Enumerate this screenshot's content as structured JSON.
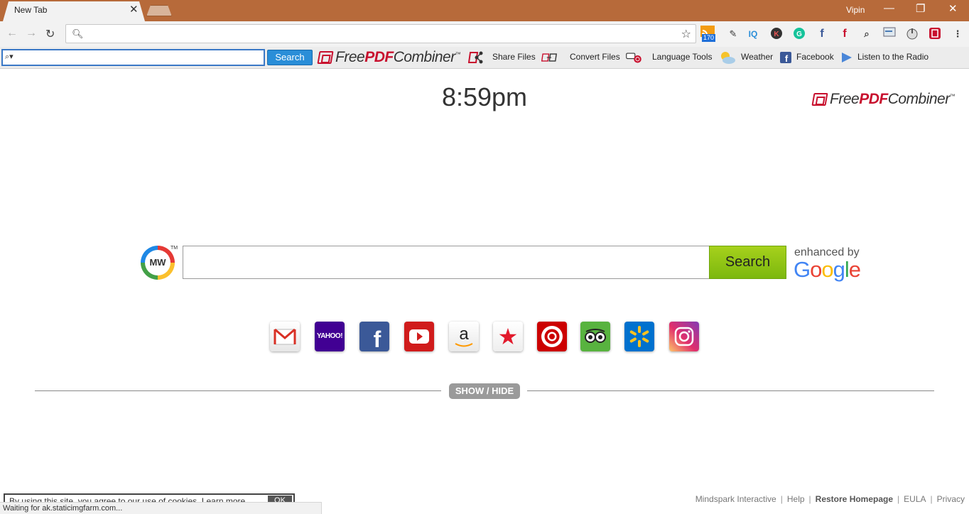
{
  "browser": {
    "tab_title": "New Tab",
    "tab_close_glyph": "✕",
    "user_name": "Vipin",
    "window_controls": {
      "minimize": "—",
      "restore": "❐",
      "close": "✕"
    },
    "rss_badge": "170",
    "address_value": ""
  },
  "toolbar": {
    "search_value": "",
    "search_button": "Search",
    "logo": {
      "prefix": "Free",
      "highlight": "PDF",
      "suffix": "Combiner",
      "tm": "™"
    },
    "items": [
      {
        "label": "Share Files",
        "icon": "share-files-icon"
      },
      {
        "label": "Convert Files",
        "icon": "convert-files-icon"
      },
      {
        "label": "Language Tools",
        "icon": "language-tools-icon"
      },
      {
        "label": "Weather",
        "icon": "weather-icon"
      },
      {
        "label": "Facebook",
        "icon": "facebook-icon"
      },
      {
        "label": "Listen to the Radio",
        "icon": "radio-play-icon"
      }
    ]
  },
  "page": {
    "clock": "8:59pm",
    "brand_logo": {
      "prefix": "Free",
      "highlight": "PDF",
      "suffix": "Combiner",
      "tm": "™"
    },
    "mw_logo": "MW",
    "mw_tm": "TM",
    "search_value": "",
    "search_button": "Search",
    "enhanced_by": "enhanced by",
    "google": [
      "G",
      "o",
      "o",
      "g",
      "l",
      "e"
    ],
    "google_colors": [
      "#4285F4",
      "#EA4335",
      "#FBBC05",
      "#4285F4",
      "#34A853",
      "#EA4335"
    ],
    "shortcuts": [
      {
        "name": "gmail",
        "label": ""
      },
      {
        "name": "yahoo",
        "label": "YAHOO!"
      },
      {
        "name": "facebook",
        "label": "f"
      },
      {
        "name": "youtube",
        "label": ""
      },
      {
        "name": "amazon",
        "label": "a"
      },
      {
        "name": "macys",
        "label": "★"
      },
      {
        "name": "target",
        "label": ""
      },
      {
        "name": "tripadvisor",
        "label": ""
      },
      {
        "name": "walmart",
        "label": ""
      },
      {
        "name": "instagram",
        "label": ""
      }
    ],
    "show_hide": "SHOW / HIDE"
  },
  "footer": {
    "links": [
      "Mindspark Interactive",
      "Help",
      "Restore Homepage",
      "EULA",
      "Privacy"
    ]
  },
  "cookie": {
    "text": "By using this site, you agree to our use of cookies. Learn more",
    "ok": "OK"
  },
  "status": "Waiting for ak.staticimgfarm.com...",
  "colors": {
    "titlebar": "#b76a3a",
    "accent_blue": "#2a8ed8",
    "search_green": "#8cc514",
    "brand_red": "#c8102e"
  }
}
